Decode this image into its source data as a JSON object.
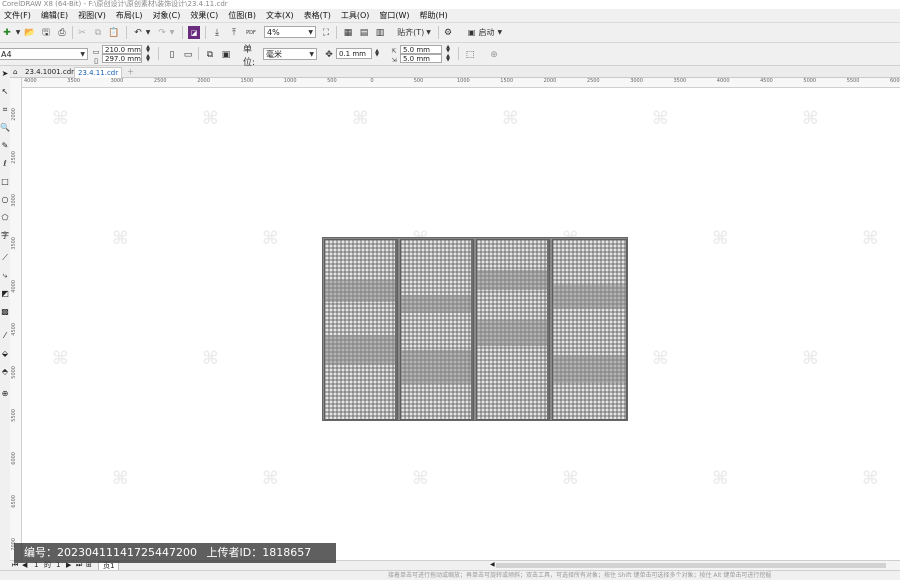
{
  "window": {
    "title": "CorelDRAW X8 (64-Bit) - F:\\原创设计\\原创素材\\装饰设计\\23.4.11.cdr"
  },
  "menu": [
    "文件(F)",
    "编辑(E)",
    "视图(V)",
    "布局(L)",
    "对象(C)",
    "效果(C)",
    "位图(B)",
    "文本(X)",
    "表格(T)",
    "工具(O)",
    "窗口(W)",
    "帮助(H)"
  ],
  "standard_toolbar": {
    "zoom": "4%",
    "snap_label": "贴齐(T)",
    "launch_label": "启动"
  },
  "property_bar": {
    "page_size": "A4",
    "width": "210.0 mm",
    "height": "297.0 mm",
    "unit_label": "单位:",
    "unit_value": "毫米",
    "nudge": "0.1 mm",
    "dup_x": "5.0 mm",
    "dup_y": "5.0 mm"
  },
  "tabs": [
    "23.4.1001.cdr",
    "23.4.11.cdr"
  ],
  "rulers": {
    "horizontal": [
      "4000",
      "3500",
      "3000",
      "2500",
      "2000",
      "1500",
      "1000",
      "500",
      "0",
      "500",
      "1000",
      "1500",
      "2000",
      "2500",
      "3000",
      "3500",
      "4000",
      "4500",
      "5000",
      "5500",
      "6000",
      "6500"
    ],
    "vertical": [
      "2000",
      "2500",
      "3000",
      "3500",
      "4000",
      "4500",
      "5000",
      "5500",
      "6000",
      "6500",
      "7000",
      "7500"
    ],
    "unit": "毫米"
  },
  "page_nav": {
    "current": "1",
    "of": "的",
    "total": "1",
    "page_tab": "页1"
  },
  "status": {
    "text": "接着单击可进行拖动或缩放；再单击可旋转或倾斜；双击工具，可选择所有对象；按住 Shift 键单击可选择多个对象；按住 Alt 键单击可进行挖掘"
  },
  "overlay": {
    "id_label": "编号：20230411141725447200",
    "uploader_label": "上传者ID：1818657"
  },
  "artwork": {
    "panel_count": 4,
    "panel_color": "#8a8a8a",
    "hole_color": "#e6e6e6"
  }
}
